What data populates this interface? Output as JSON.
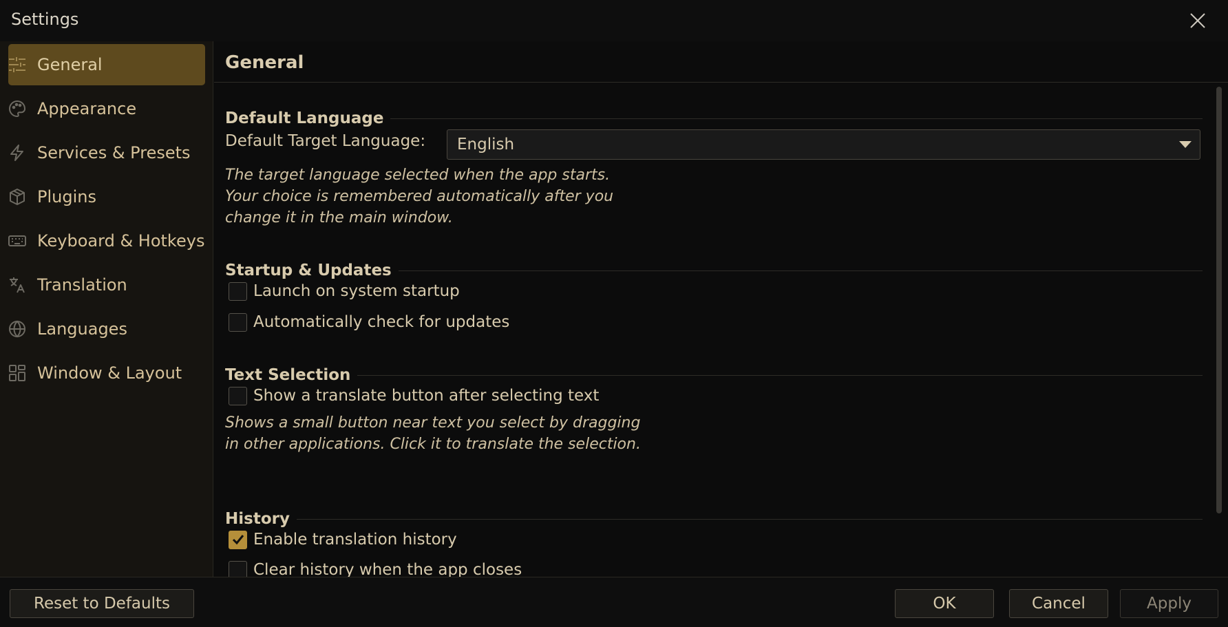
{
  "window": {
    "title": "Settings"
  },
  "sidebar": {
    "items": [
      {
        "label": "General",
        "icon": "sliders-icon",
        "active": true
      },
      {
        "label": "Appearance",
        "icon": "palette-icon"
      },
      {
        "label": "Services & Presets",
        "icon": "lightning-icon"
      },
      {
        "label": "Plugins",
        "icon": "package-icon"
      },
      {
        "label": "Keyboard & Hotkeys",
        "icon": "keyboard-icon"
      },
      {
        "label": "Translation",
        "icon": "translate-icon"
      },
      {
        "label": "Languages",
        "icon": "globe-icon"
      },
      {
        "label": "Window & Layout",
        "icon": "layout-grid-icon"
      }
    ]
  },
  "page": {
    "title": "General",
    "sections": {
      "default_language": {
        "heading": "Default Language",
        "target_label": "Default Target Language:",
        "target_value": "English",
        "help": "The target language selected when the app starts. Your choice is remembered automatically after you change it in the main window."
      },
      "startup": {
        "heading": "Startup & Updates",
        "launch_label": "Launch on system startup",
        "launch_checked": false,
        "updates_label": "Automatically check for updates",
        "updates_checked": false
      },
      "text_selection": {
        "heading": "Text Selection",
        "translate_button_label": "Show a translate button after selecting text",
        "translate_button_checked": false,
        "help": "Shows a small button near text you select by dragging in other applications. Click it to translate the selection."
      },
      "history": {
        "heading": "History",
        "enable_label": "Enable translation history",
        "enable_checked": true,
        "clear_label": "Clear history when the app closes",
        "clear_checked": false
      }
    }
  },
  "footer": {
    "reset_label": "Reset to Defaults",
    "ok_label": "OK",
    "cancel_label": "Cancel",
    "apply_label": "Apply"
  },
  "colors": {
    "accent": "#b58f3a",
    "active_nav": "#5e4a1e",
    "text": "#d8cbad",
    "background": "#0c0c0c"
  }
}
